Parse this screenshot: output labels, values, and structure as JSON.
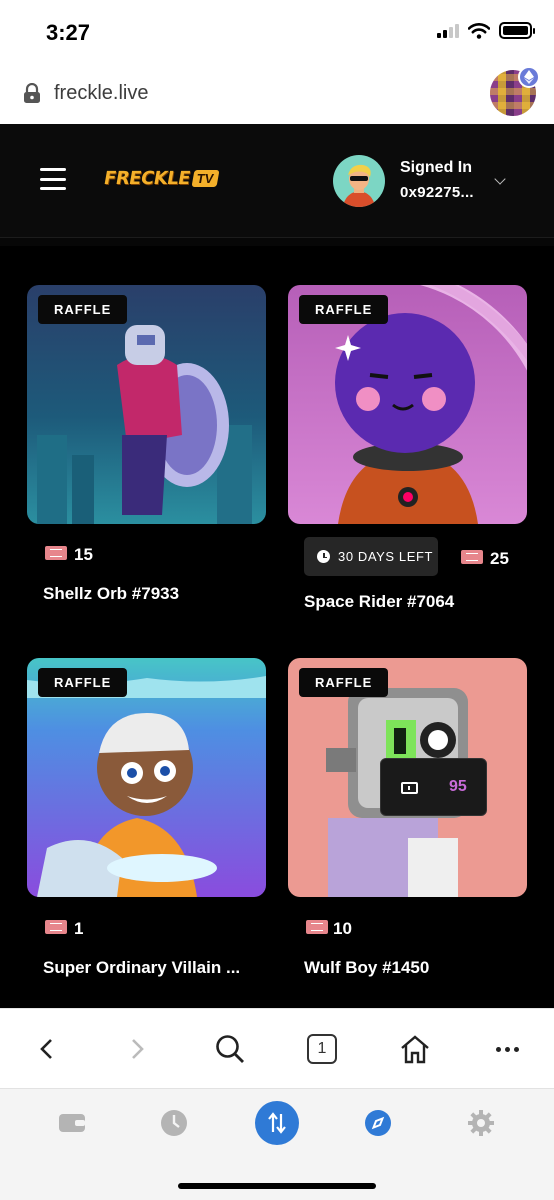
{
  "status_bar": {
    "time": "3:27"
  },
  "browser": {
    "url": "freckle.live",
    "tab_count": "1"
  },
  "header": {
    "logo_text": "FRECKLE",
    "logo_badge": "TV",
    "signed_in_label": "Signed In",
    "wallet_address": "0x92275..."
  },
  "cards": [
    {
      "tag": "RAFFLE",
      "tickets": "15",
      "title": "Shellz Orb #7933"
    },
    {
      "tag": "RAFFLE",
      "tickets": "25",
      "title": "Space Rider #7064",
      "time_left": "30 DAYS LEFT"
    },
    {
      "tag": "RAFFLE",
      "tickets": "1",
      "title": "Super Ordinary Villain ..."
    },
    {
      "tag": "RAFFLE",
      "tickets": "10",
      "title": "Wulf Boy #1450"
    }
  ],
  "floating_ticket_counter": "95",
  "colors": {
    "brand_gold": "#f4b02a",
    "ticket_pink": "#e7868c",
    "counter_purple": "#c86bd8",
    "active_tab_blue": "#2f7ad6"
  },
  "icons": {
    "browser_toolbar": [
      "back-icon",
      "forward-icon",
      "search-icon",
      "tabs-icon",
      "home-icon",
      "more-icon"
    ],
    "app_tabbar": [
      "wallet-icon",
      "history-icon",
      "swap-icon",
      "browser-icon",
      "settings-icon"
    ]
  }
}
